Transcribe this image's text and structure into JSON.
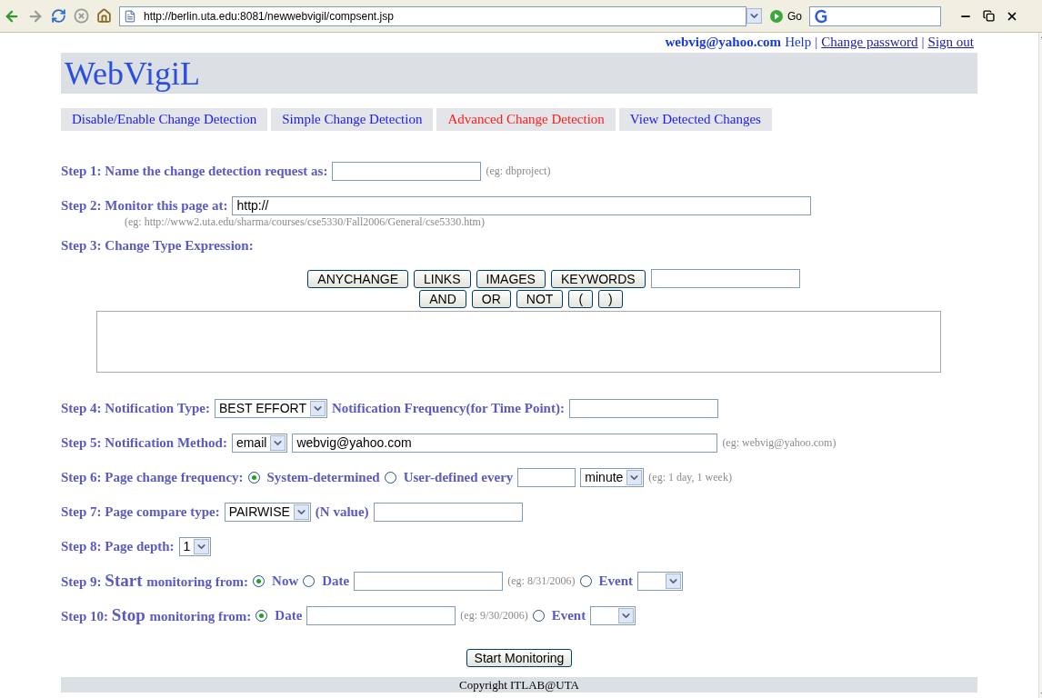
{
  "browser": {
    "address": "http://berlin.uta.edu:8081/newwebvigil/compsent.jsp",
    "go": "Go"
  },
  "header": [
    {
      "kind": "user",
      "text": "webvig@yahoo.com"
    },
    {
      "kind": "plain",
      "text": "Help"
    },
    {
      "kind": "sep",
      "text": "|"
    },
    {
      "kind": "link",
      "text": "Change password"
    },
    {
      "kind": "sep",
      "text": "|"
    },
    {
      "kind": "link",
      "text": "Sign out"
    }
  ],
  "title": "WebVigiL",
  "tabs": [
    {
      "label": "Disable/Enable Change Detection",
      "selected": false
    },
    {
      "label": "Simple Change Detection",
      "selected": false
    },
    {
      "label": "Advanced Change Detection",
      "selected": true
    },
    {
      "label": "View Detected Changes",
      "selected": false
    }
  ],
  "steps": [
    {
      "kind": "row",
      "parts": [
        {
          "kind": "label",
          "text": "Step 1: Name the change detection request as:"
        },
        {
          "kind": "input"
        },
        {
          "kind": "hint",
          "text": "(eg: dbproject)"
        }
      ]
    },
    {
      "kind": "row",
      "parts": [
        {
          "kind": "label",
          "text": "Step 2: Monitor this page at:"
        },
        {
          "kind": "long_input",
          "value": "http://"
        }
      ],
      "note": "(eg: http://www2.uta.edu/sharma/courses/cse5330/Fall2006/General/cse5330.htm)"
    },
    {
      "kind": "expression",
      "parts": [
        {
          "kind": "label",
          "text": "Step 3: Change Type Expression:"
        }
      ],
      "buttons": [
        [
          "ANYCHANGE",
          "LINKS",
          "IMAGES",
          "KEYWORDS"
        ],
        [
          "AND",
          "OR",
          "NOT",
          "(",
          ")"
        ]
      ]
    },
    {
      "kind": "row",
      "parts": [
        {
          "kind": "label",
          "text": "Step 4: Notification Type:"
        },
        {
          "kind": "select",
          "value": "BEST EFFORT"
        },
        {
          "kind": "label",
          "text": "Notification Frequency(for Time Point):"
        },
        {
          "kind": "input"
        }
      ]
    },
    {
      "kind": "row",
      "parts": [
        {
          "kind": "label",
          "text": "Step 5: Notification Method:"
        },
        {
          "kind": "select",
          "value": "email"
        },
        {
          "kind": "wide_input",
          "value": "webvig@yahoo.com"
        },
        {
          "kind": "hint",
          "text": "(eg: webvig@yahoo.com)"
        }
      ]
    },
    {
      "kind": "row",
      "parts": [
        {
          "kind": "label",
          "text": "Step 6: Page change frequency:"
        },
        {
          "kind": "radio",
          "label": "System-determined",
          "selected": true
        },
        {
          "kind": "radio",
          "label": "User-defined every",
          "selected": false
        },
        {
          "kind": "short_input"
        },
        {
          "kind": "select",
          "value": "minute"
        },
        {
          "kind": "hint",
          "text": "(eg: 1 day, 1 week)"
        }
      ]
    },
    {
      "kind": "row",
      "parts": [
        {
          "kind": "label",
          "text": "Step 7: Page compare type:"
        },
        {
          "kind": "select",
          "value": "PAIRWISE"
        },
        {
          "kind": "label",
          "text": "(N value)"
        },
        {
          "kind": "input"
        }
      ]
    },
    {
      "kind": "row",
      "parts": [
        {
          "kind": "label",
          "text": "Step 8: Page depth:"
        },
        {
          "kind": "select",
          "value": "1"
        }
      ]
    },
    {
      "kind": "row",
      "parts": [
        {
          "kind": "mixed",
          "parts": [
            {
              "text": "Step 9:",
              "large": false
            },
            {
              "text": "Start",
              "large": true
            },
            {
              "text": "monitoring from:",
              "large": false
            }
          ]
        },
        {
          "kind": "radio",
          "label": "Now",
          "selected": true
        },
        {
          "kind": "radio",
          "label": "Date",
          "selected": false
        },
        {
          "kind": "input"
        },
        {
          "kind": "hint",
          "text": "(eg: 8/31/2006)"
        },
        {
          "kind": "radio",
          "label": "Event",
          "selected": false
        },
        {
          "kind": "select"
        }
      ]
    },
    {
      "kind": "row",
      "parts": [
        {
          "kind": "mixed",
          "parts": [
            {
              "text": "Step 10:",
              "large": false
            },
            {
              "text": "Stop",
              "large": true
            },
            {
              "text": "monitoring from:",
              "large": false
            }
          ]
        },
        {
          "kind": "radio",
          "label": "Date",
          "selected": true
        },
        {
          "kind": "input"
        },
        {
          "kind": "hint",
          "text": "(eg: 9/30/2006)"
        },
        {
          "kind": "radio",
          "label": "Event",
          "selected": false
        },
        {
          "kind": "select"
        }
      ]
    }
  ],
  "submit": "Start Monitoring",
  "footer": "Copyright ITLAB@UTA"
}
